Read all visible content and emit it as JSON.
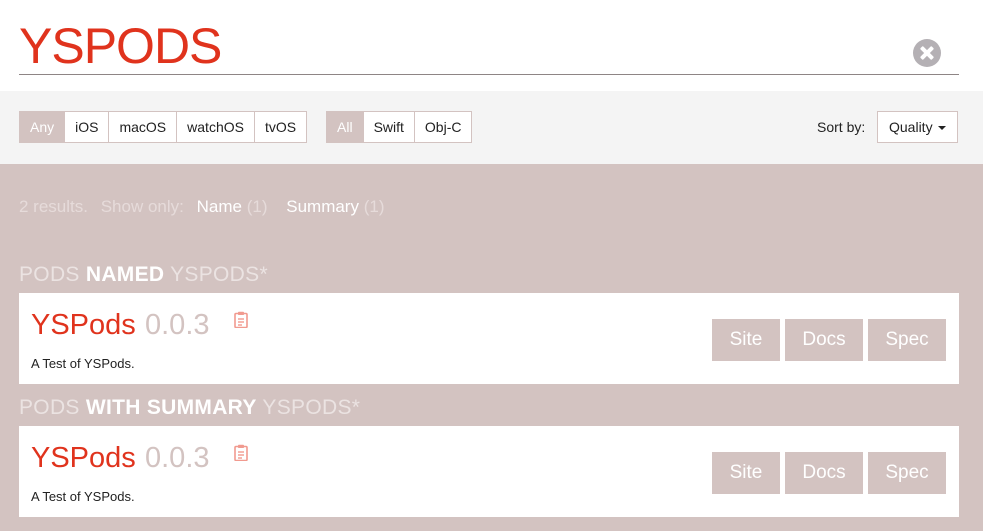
{
  "search": {
    "value": "YSPODS"
  },
  "filters": {
    "platforms": [
      "Any",
      "iOS",
      "macOS",
      "watchOS",
      "tvOS"
    ],
    "languages": [
      "All",
      "Swift",
      "Obj-C"
    ],
    "sort_label": "Sort by:",
    "sort_value": "Quality"
  },
  "results": {
    "count_text": "2 results.",
    "show_only_text": "Show only:",
    "name_filter": "Name",
    "name_count": "(1)",
    "summary_filter": "Summary",
    "summary_count": "(1)"
  },
  "sections": [
    {
      "title_prefix": "PODS ",
      "title_bold": "NAMED",
      "title_suffix": " YSPODS*",
      "pod": {
        "name": "YSPods",
        "version": "0.0.3",
        "summary": "A Test of YSPods."
      }
    },
    {
      "title_prefix": "PODS ",
      "title_bold": "WITH SUMMARY",
      "title_suffix": " YSPODS*",
      "pod": {
        "name": "YSPods",
        "version": "0.0.3",
        "summary": "A Test of YSPods."
      }
    }
  ],
  "actions": {
    "site": "Site",
    "docs": "Docs",
    "spec": "Spec"
  },
  "icons": {
    "clear": "close-circle-icon",
    "copy": "clipboard-icon",
    "sort": "caret-down-icon"
  },
  "colors": {
    "accent": "#e0331d",
    "muted": "#d3c3c1",
    "filter_bg": "#f4f4f4"
  }
}
